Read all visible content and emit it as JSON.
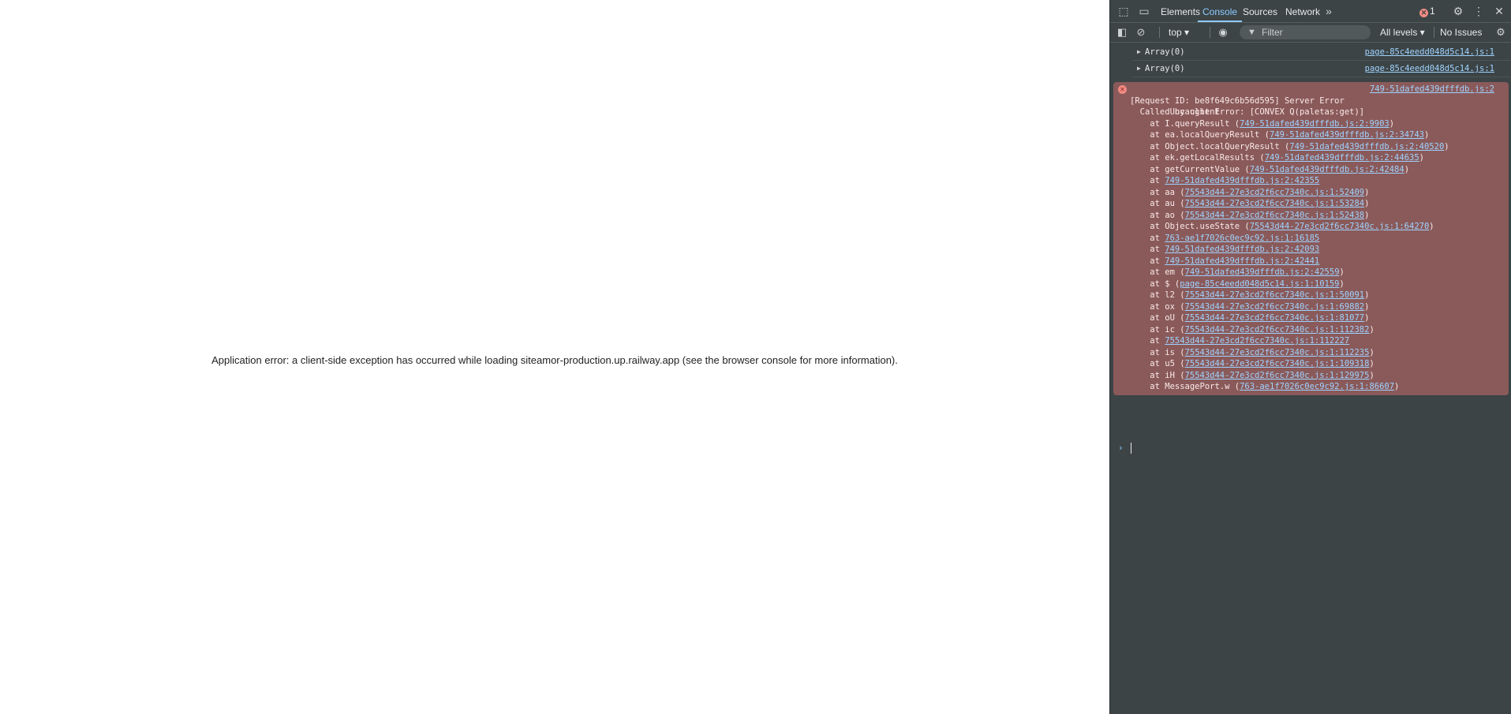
{
  "page": {
    "error_message": "Application error: a client-side exception has occurred while loading siteamor-production.up.railway.app (see the browser console for more information)."
  },
  "devtools": {
    "tabs": [
      {
        "label": "Elements"
      },
      {
        "label": "Console"
      },
      {
        "label": "Sources"
      },
      {
        "label": "Network"
      }
    ],
    "error_count": "1",
    "toolbar": {
      "context": "top ▾",
      "filter_placeholder": "Filter",
      "levels": "All levels ▾",
      "issues": "No Issues"
    },
    "logs": [
      {
        "text": "Array(0)",
        "source": "page-85c4eedd048d5c14.js:1"
      },
      {
        "text": "Array(0)",
        "source": "page-85c4eedd048d5c14.js:1"
      }
    ],
    "error": {
      "title": "Uncaught Error: [CONVEX Q(paletas:get)]",
      "source": "749-51dafed439dfffdb.js:2",
      "line2": "[Request ID: be8f649c6b56d595] Server Error",
      "line3": "  Called by client",
      "stack": [
        {
          "prefix": "    at I.queryResult (",
          "link": "749-51dafed439dfffdb.js:2:9903",
          "suffix": ")"
        },
        {
          "prefix": "    at ea.localQueryResult (",
          "link": "749-51dafed439dfffdb.js:2:34743",
          "suffix": ")"
        },
        {
          "prefix": "    at Object.localQueryResult (",
          "link": "749-51dafed439dfffdb.js:2:40520",
          "suffix": ")"
        },
        {
          "prefix": "    at ek.getLocalResults (",
          "link": "749-51dafed439dfffdb.js:2:44635",
          "suffix": ")"
        },
        {
          "prefix": "    at getCurrentValue (",
          "link": "749-51dafed439dfffdb.js:2:42484",
          "suffix": ")"
        },
        {
          "prefix": "    at ",
          "link": "749-51dafed439dfffdb.js:2:42355",
          "suffix": ""
        },
        {
          "prefix": "    at aa (",
          "link": "75543d44-27e3cd2f6cc7340c.js:1:52409",
          "suffix": ")"
        },
        {
          "prefix": "    at au (",
          "link": "75543d44-27e3cd2f6cc7340c.js:1:53284",
          "suffix": ")"
        },
        {
          "prefix": "    at ao (",
          "link": "75543d44-27e3cd2f6cc7340c.js:1:52438",
          "suffix": ")"
        },
        {
          "prefix": "    at Object.useState (",
          "link": "75543d44-27e3cd2f6cc7340c.js:1:64270",
          "suffix": ")"
        },
        {
          "prefix": "    at ",
          "link": "763-ae1f7026c0ec9c92.js:1:16185",
          "suffix": ""
        },
        {
          "prefix": "    at ",
          "link": "749-51dafed439dfffdb.js:2:42093",
          "suffix": ""
        },
        {
          "prefix": "    at ",
          "link": "749-51dafed439dfffdb.js:2:42441",
          "suffix": ""
        },
        {
          "prefix": "    at em (",
          "link": "749-51dafed439dfffdb.js:2:42559",
          "suffix": ")"
        },
        {
          "prefix": "    at $ (",
          "link": "page-85c4eedd048d5c14.js:1:10159",
          "suffix": ")"
        },
        {
          "prefix": "    at l2 (",
          "link": "75543d44-27e3cd2f6cc7340c.js:1:50091",
          "suffix": ")"
        },
        {
          "prefix": "    at ox (",
          "link": "75543d44-27e3cd2f6cc7340c.js:1:69882",
          "suffix": ")"
        },
        {
          "prefix": "    at oU (",
          "link": "75543d44-27e3cd2f6cc7340c.js:1:81077",
          "suffix": ")"
        },
        {
          "prefix": "    at ic (",
          "link": "75543d44-27e3cd2f6cc7340c.js:1:112382",
          "suffix": ")"
        },
        {
          "prefix": "    at ",
          "link": "75543d44-27e3cd2f6cc7340c.js:1:112227",
          "suffix": ""
        },
        {
          "prefix": "    at is (",
          "link": "75543d44-27e3cd2f6cc7340c.js:1:112235",
          "suffix": ")"
        },
        {
          "prefix": "    at u5 (",
          "link": "75543d44-27e3cd2f6cc7340c.js:1:109318",
          "suffix": ")"
        },
        {
          "prefix": "    at iH (",
          "link": "75543d44-27e3cd2f6cc7340c.js:1:129975",
          "suffix": ")"
        },
        {
          "prefix": "    at MessagePort.w (",
          "link": "763-ae1f7026c0ec9c92.js:1:86607",
          "suffix": ")"
        }
      ]
    },
    "colors": {
      "panel_bg": "#3c4446",
      "error_bg": "#8a5a5a",
      "link": "#9fd3ff",
      "active_tab": "#8ecbff"
    }
  }
}
